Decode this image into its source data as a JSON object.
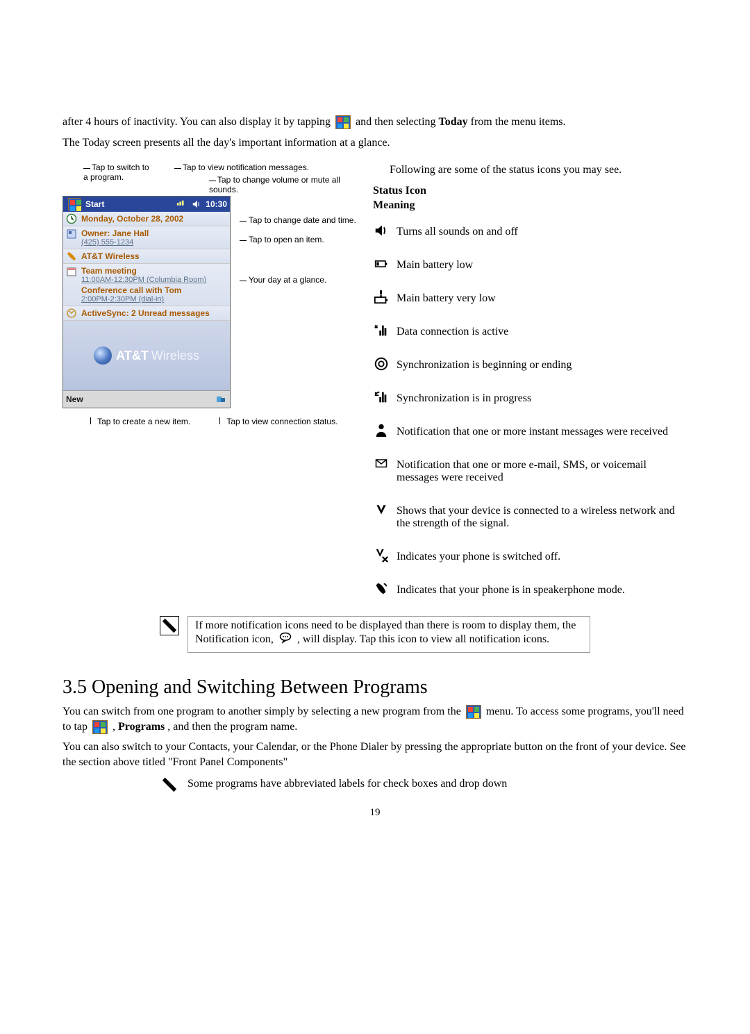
{
  "intro": {
    "line1a": "after 4 hours of inactivity.  You can also display it by tapping ",
    "line1b": " and then selecting ",
    "line1_bold": "Today",
    "line1c": " from the menu items.",
    "line2": "The Today screen presents all the day's important information at a glance."
  },
  "diagram": {
    "ann_switch_program": "Tap to switch to a program.",
    "ann_view_notifications": "Tap to view notification messages.",
    "ann_change_volume": "Tap to change volume or mute all sounds.",
    "ann_change_datetime": "Tap to change date and time.",
    "ann_open_item": "Tap to open an item.",
    "ann_day_glance": "Your day at a glance.",
    "ann_create_new": "Tap to create a new item.",
    "ann_view_connection": "Tap to view connection status."
  },
  "today": {
    "start_label": "Start",
    "time": "10:30",
    "date": "Monday, October 28, 2002",
    "owner_title": "Owner: Jane Hall",
    "owner_phone": "(425) 555-1234",
    "carrier": "AT&T Wireless",
    "meeting1_title": "Team meeting",
    "meeting1_sub": "11:00AM-12:30PM (Columbia Room)",
    "meeting2_title": "Conference call with Tom",
    "meeting2_sub": "2:00PM-2:30PM (dial-in)",
    "activesync": "ActiveSync: 2 Unread messages",
    "logo_brand": "AT&T",
    "logo_sub": "Wireless",
    "new_label": "New"
  },
  "status": {
    "intro": "Following are some of the status icons you may see.",
    "head1": "Status Icon",
    "head2": "Meaning",
    "items": {
      "i0": "Turns all sounds on and off",
      "i1": "Main battery low",
      "i2": "Main battery very low",
      "i3": "Data connection is active",
      "i4": "Synchronization is beginning or ending",
      "i5": "Synchronization is in progress",
      "i6": "Notification that one or more instant messages were received",
      "i7": "Notification that one or more e-mail, SMS, or voicemail messages were received",
      "i8": "Shows that your device is connected to a wireless network and the strength of the signal.",
      "i9": "Indicates your phone is switched off.",
      "i10": "Indicates that your phone is in speakerphone mode."
    }
  },
  "note1": {
    "a": "If more notification icons need to be displayed than there is room to display them, the Notification icon, ",
    "b": ", will display. Tap this icon to view all notification icons."
  },
  "section35": {
    "heading": "3.5 Opening and Switching Between Programs",
    "p1a": "You can switch from one program to another simply by selecting a new program from the ",
    "p1b": " menu.  To access some programs, you'll need to tap ",
    "p1c": ", ",
    "p1_bold": "Programs",
    "p1d": ", and then the program name.",
    "p2": "You can also switch to your Contacts, your Calendar, or the Phone Dialer by pressing the appropriate button on the front of your device.  See the section above titled \"Front Panel Components\""
  },
  "note2": {
    "text": "Some programs have abbreviated labels for check boxes and drop down"
  },
  "page_number": "19"
}
